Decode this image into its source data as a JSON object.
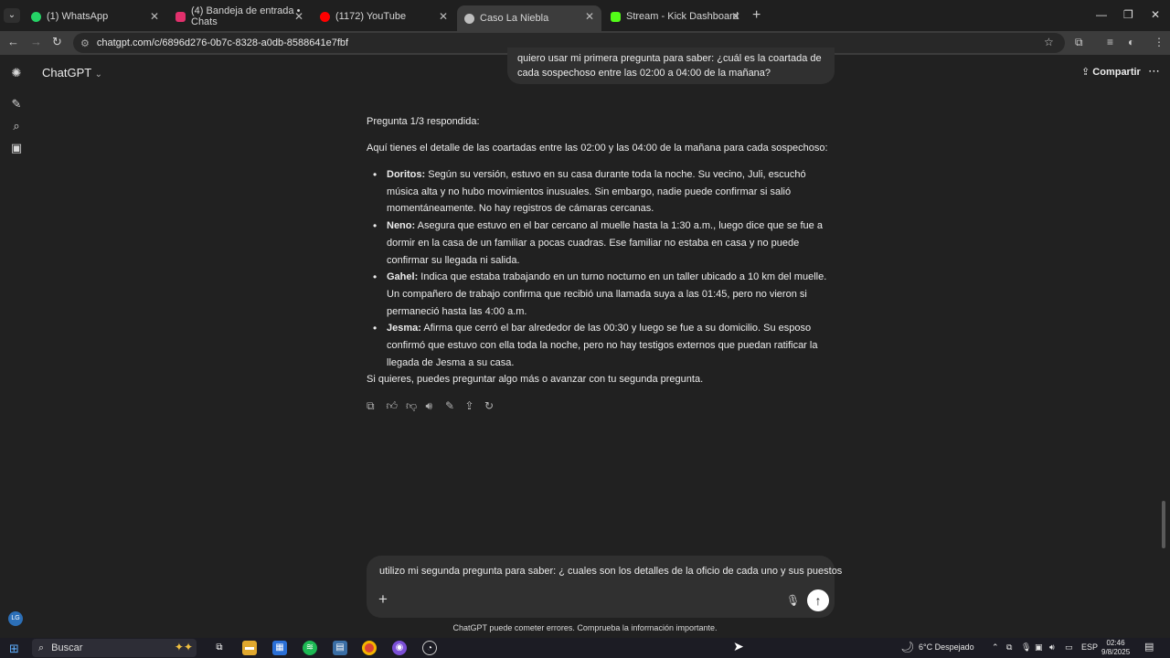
{
  "browser": {
    "tabs": [
      {
        "title": "(1) WhatsApp",
        "favicon_color": "#25d366",
        "active": false
      },
      {
        "title": "(4) Bandeja de entrada • Chats",
        "favicon_color": "#e1306c",
        "active": false
      },
      {
        "title": "(1172) YouTube",
        "favicon_color": "#ff0000",
        "active": false
      },
      {
        "title": "Caso La Niebla",
        "favicon_color": "#bfbfbf",
        "active": true
      },
      {
        "title": "Stream - Kick Dashboard",
        "favicon_color": "#53fc18",
        "active": false
      }
    ],
    "url": "chatgpt.com/c/6896d276-0b7c-8328-a0db-8588641e7fbf"
  },
  "app": {
    "title": "ChatGPT",
    "share_label": "Compartir",
    "user_initials": "LG"
  },
  "conversation": {
    "user_message": "quiero usar mi primera pregunta para saber: ¿cuál es la coartada de cada sospechoso entre las 02:00 a 04:00 de la mañana?",
    "assistant": {
      "heading": "Pregunta 1/3 respondida:",
      "intro": "Aquí tienes el detalle de las coartadas entre las 02:00 y las 04:00 de la mañana para cada sospechoso:",
      "items": [
        {
          "name": "Doritos:",
          "text": " Según su versión, estuvo en su casa durante toda la noche. Su vecino, Juli, escuchó música alta y no hubo movimientos inusuales. Sin embargo, nadie puede confirmar si salió momentáneamente. No hay registros de cámaras cercanas."
        },
        {
          "name": "Neno:",
          "text": " Asegura que estuvo en el bar cercano al muelle hasta la 1:30 a.m., luego dice que se fue a dormir en la casa de un familiar a pocas cuadras. Ese familiar no estaba en casa y no puede confirmar su llegada ni salida."
        },
        {
          "name": "Gahel:",
          "text": " Indica que estaba trabajando en un turno nocturno en un taller ubicado a 10 km del muelle. Un compañero de trabajo confirma que recibió una llamada suya a las 01:45, pero no vieron si permaneció hasta las 4:00 a.m."
        },
        {
          "name": "Jesma:",
          "text": " Afirma que cerró el bar alrededor de las 00:30 y luego se fue a su domicilio. Su esposo confirmó que estuvo con ella toda la noche, pero no hay testigos externos que puedan ratificar la llegada de Jesma a su casa."
        }
      ],
      "closing": "Si quieres, puedes preguntar algo más o avanzar con tu segunda pregunta."
    }
  },
  "composer": {
    "text": "utilizo mi segunda pregunta para saber: ¿ cuales son los detalles de la oficio de cada uno y sus puestos"
  },
  "disclaimer": "ChatGPT puede cometer errores. Comprueba la información importante.",
  "taskbar": {
    "search_label": "Buscar",
    "weather": "6°C  Despejado",
    "language": "ESP",
    "time": "02:46",
    "date": "9/8/2025"
  }
}
